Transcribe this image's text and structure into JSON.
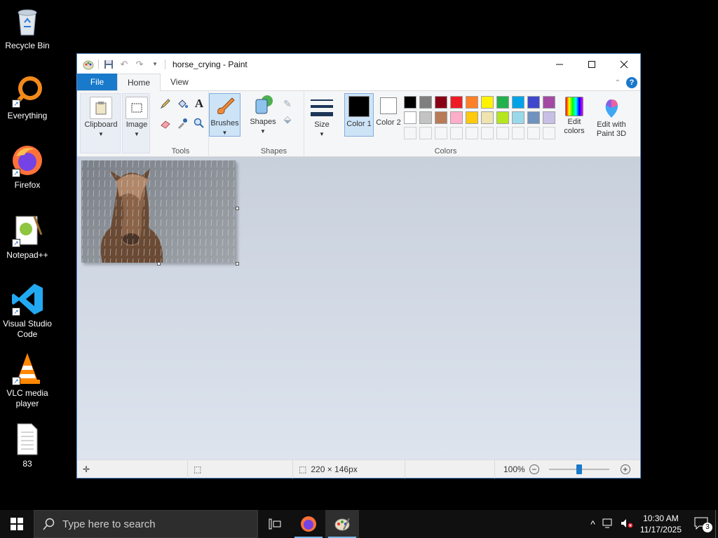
{
  "desktop": {
    "icons": [
      {
        "label": "Recycle Bin"
      },
      {
        "label": "Everything"
      },
      {
        "label": "Firefox"
      },
      {
        "label": "Notepad++"
      },
      {
        "label": "Visual Studio Code"
      },
      {
        "label": "VLC media player"
      },
      {
        "label": "83"
      }
    ]
  },
  "window": {
    "title": "horse_crying - Paint",
    "tabs": {
      "file": "File",
      "home": "Home",
      "view": "View"
    },
    "ribbon": {
      "clipboard": "Clipboard",
      "image": "Image",
      "tools_label": "Tools",
      "brushes": "Brushes",
      "shapes": "Shapes",
      "shapes_group": "Shapes",
      "size": "Size",
      "color1": "Color 1",
      "color2": "Color 2",
      "colors_group": "Colors",
      "edit_colors": "Edit colors",
      "edit_paint3d": "Edit with Paint 3D"
    },
    "palette_row1": [
      "#000000",
      "#7f7f7f",
      "#880015",
      "#ed1c24",
      "#ff7f27",
      "#fff200",
      "#22b14c",
      "#00a2e8",
      "#3f48cc",
      "#a349a4"
    ],
    "palette_row2": [
      "#ffffff",
      "#c3c3c3",
      "#b97a57",
      "#ffaec9",
      "#ffc90e",
      "#efe4b0",
      "#b5e61d",
      "#99d9ea",
      "#7092be",
      "#c8bfe7"
    ],
    "color1_value": "#000000",
    "color2_value": "#ffffff",
    "status": {
      "image_size": "220 × 146px",
      "zoom": "100%"
    }
  },
  "taskbar": {
    "search_placeholder": "Type here to search",
    "time": "10:30 AM",
    "date": "11/17/2025",
    "notification_count": "3"
  }
}
